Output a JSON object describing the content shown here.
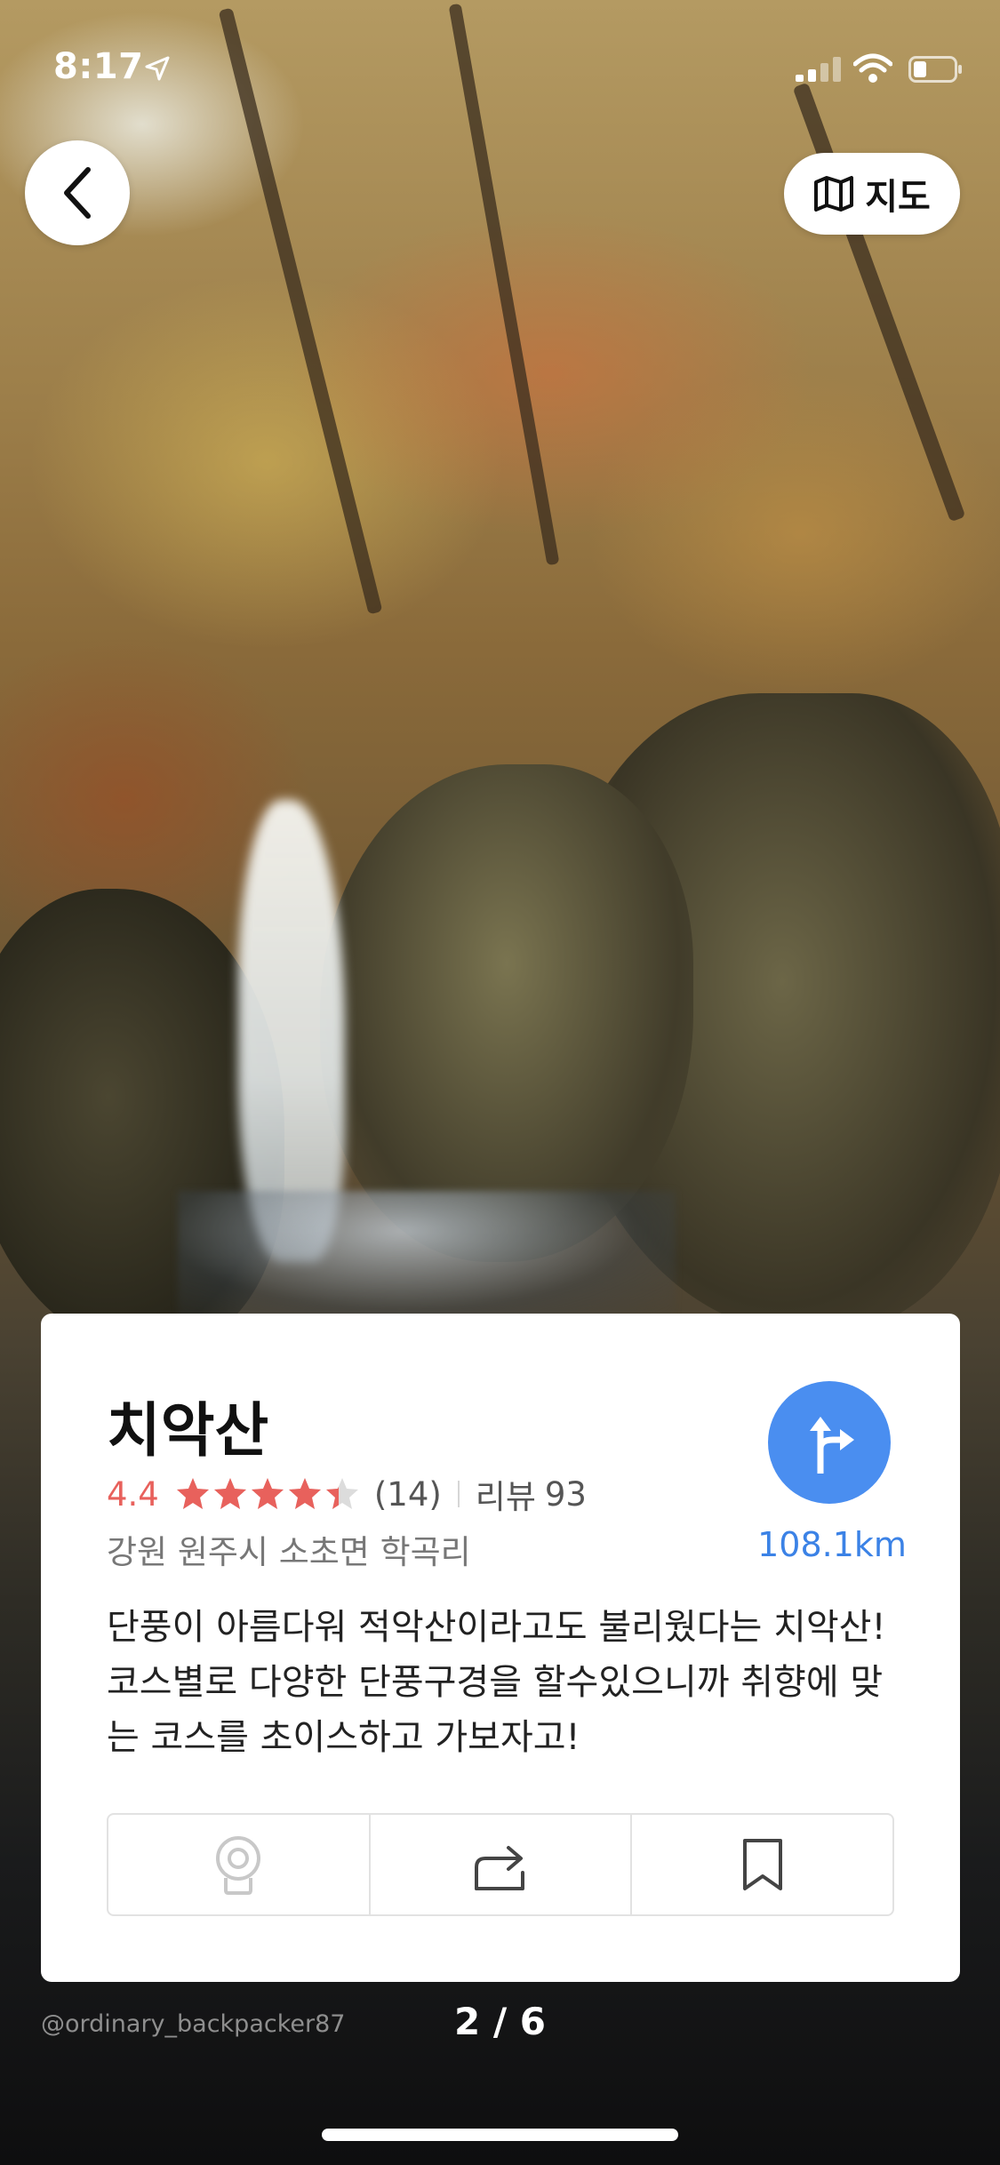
{
  "status_bar": {
    "time": "8:17"
  },
  "top_bar": {
    "map_button_label": "지도"
  },
  "place": {
    "name": "치악산",
    "rating": "4.4",
    "rating_value": 4.4,
    "rating_max": 5,
    "rating_count": "(14)",
    "review_label": "리뷰",
    "review_count": "93",
    "address": "강원 원주시 소초면 학곡리",
    "distance": "108.1km",
    "description": "단풍이 아름다워 적악산이라고도 불리웠다는 치악산! 코스별로 다양한 단풍구경을 할수있으니까 취향에 맞는 코스를 초이스하고 가보자고!"
  },
  "actions": [
    {
      "icon": "pin-icon"
    },
    {
      "icon": "share-icon"
    },
    {
      "icon": "bookmark-icon"
    }
  ],
  "footer": {
    "credit": "@ordinary_backpacker87",
    "pager": "2 / 6"
  },
  "colors": {
    "accent_blue": "#4a8ef0",
    "distance_blue": "#3b82e6",
    "rating_red": "#e8615c"
  }
}
